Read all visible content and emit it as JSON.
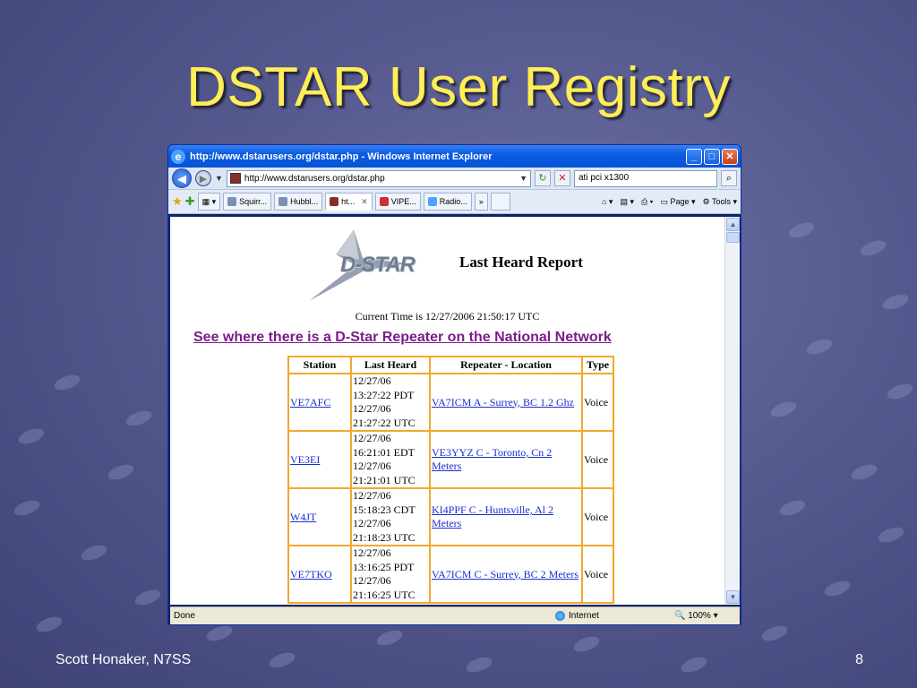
{
  "slide": {
    "title": "DSTAR User Registry",
    "footer_author": "Scott Honaker, N7SS",
    "page_number": "8"
  },
  "browser": {
    "window_title": "http://www.dstarusers.org/dstar.php - Windows Internet Explorer",
    "address": "http://www.dstarusers.org/dstar.php",
    "search_text": "ati pci x1300",
    "tabs": [
      {
        "label": "Squirr...",
        "active": false
      },
      {
        "label": "Hubbl...",
        "active": false
      },
      {
        "label": "ht...",
        "active": true
      },
      {
        "label": "VIPE...",
        "active": false
      },
      {
        "label": "Radio...",
        "active": false
      }
    ],
    "tabs_more": "»",
    "tools": {
      "page": "Page",
      "tools": "Tools"
    },
    "status_text": "Done",
    "zone_text": "Internet",
    "zoom_text": "100%"
  },
  "page": {
    "logo_text": "D-STAR",
    "report_title": "Last Heard Report",
    "current_time": "Current Time is 12/27/2006 21:50:17 UTC",
    "network_link": "See where there is a D-Star Repeater on the National Network",
    "table": {
      "headers": [
        "Station",
        "Last Heard",
        "Repeater - Location",
        "Type"
      ],
      "rows": [
        {
          "station": "VE7AFC",
          "heard_lines": [
            "12/27/06",
            "13:27:22 PDT",
            "12/27/06",
            "21:27:22 UTC"
          ],
          "repeater": "VA7ICM A - Surrey, BC 1.2 Ghz",
          "type": "Voice"
        },
        {
          "station": "VE3EI",
          "heard_lines": [
            "12/27/06",
            "16:21:01 EDT",
            "12/27/06",
            "21:21:01 UTC"
          ],
          "repeater": "VE3YYZ C - Toronto, Cn 2 Meters",
          "type": "Voice"
        },
        {
          "station": "W4JT",
          "heard_lines": [
            "12/27/06",
            "15:18:23 CDT",
            "12/27/06",
            "21:18:23 UTC"
          ],
          "repeater": "KI4PPF C - Huntsville, Al 2 Meters",
          "type": "Voice"
        },
        {
          "station": "VE7TKO",
          "heard_lines": [
            "12/27/06",
            "13:16:25 PDT",
            "12/27/06",
            "21:16:25 UTC"
          ],
          "repeater": "VA7ICM C - Surrey, BC 2 Meters",
          "type": "Voice"
        }
      ]
    }
  }
}
